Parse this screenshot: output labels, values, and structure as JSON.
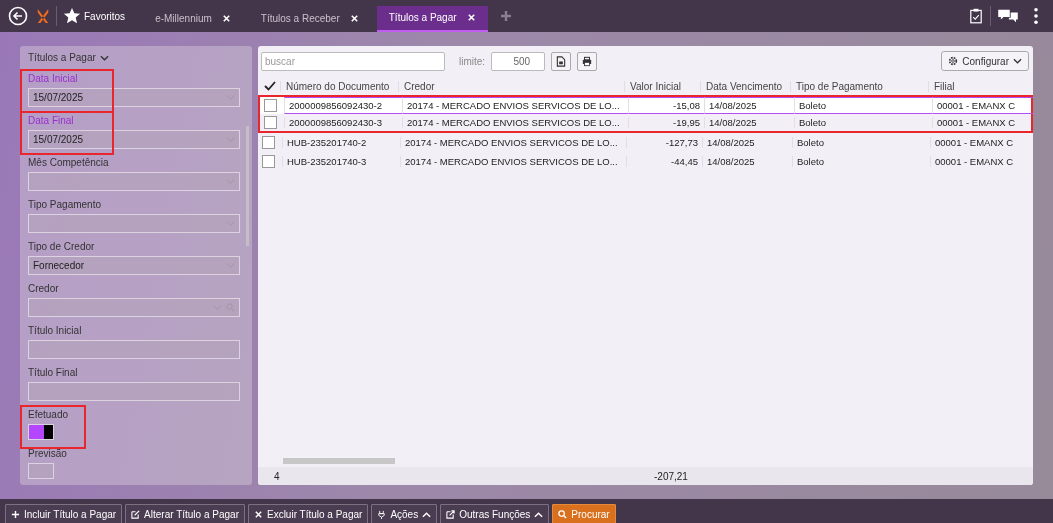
{
  "top_bar": {
    "favorites": {
      "label": "Favoritos"
    },
    "tabs": [
      {
        "label": "e-Millennium",
        "selected": false
      },
      {
        "label": "Títulos a Receber",
        "selected": false
      },
      {
        "label": "Títulos a Pagar",
        "selected": true
      }
    ]
  },
  "filter_panel": {
    "title": "Títulos a Pagar",
    "fields": [
      {
        "label": "Data Inicial",
        "kind": "select",
        "value": "15/07/2025",
        "required": true,
        "highlighted": true
      },
      {
        "label": "Data Final",
        "kind": "select",
        "value": "15/07/2025",
        "required": true,
        "highlighted": true
      },
      {
        "label": "Mês Competência",
        "kind": "select",
        "required": false,
        "highlighted": false
      },
      {
        "label": "Tipo Pagamento",
        "kind": "select",
        "required": false,
        "highlighted": false
      },
      {
        "label": "Tipo de Credor",
        "kind": "select",
        "value": "Fornecedor",
        "required": false,
        "highlighted": false
      },
      {
        "label": "Credor",
        "kind": "lookup",
        "required": false,
        "highlighted": false
      },
      {
        "label": "Título Inicial",
        "kind": "text",
        "required": false,
        "highlighted": false
      },
      {
        "label": "Título Final",
        "kind": "text",
        "required": false,
        "highlighted": false
      },
      {
        "label": "Efetuado",
        "kind": "toggle",
        "on": true,
        "required": false,
        "highlighted": true
      },
      {
        "label": "Previsão",
        "kind": "toggle",
        "on": false,
        "required": false,
        "highlighted": false
      }
    ]
  },
  "results": {
    "search": {
      "placeholder": "buscar"
    },
    "limit": {
      "label": "limite:",
      "value": "500"
    },
    "configure": {
      "label": "Configurar"
    },
    "columns": [
      "Número do Documento",
      "Credor",
      "Valor Inicial",
      "Data Vencimento",
      "Tipo de Pagamento",
      "Filial"
    ],
    "rows": [
      {
        "cells": [
          "2000009856092430-2",
          "20174 - MERCADO ENVIOS SERVICOS DE LO...",
          "-15,08",
          "14/08/2025",
          "Boleto",
          "00001 - EMANX C"
        ],
        "checked": false,
        "selected": true,
        "highlighted": true
      },
      {
        "cells": [
          "2000009856092430-3",
          "20174 - MERCADO ENVIOS SERVICOS DE LO...",
          "-19,95",
          "14/08/2025",
          "Boleto",
          "00001 - EMANX C"
        ],
        "checked": false,
        "selected": false,
        "highlighted": true
      },
      {
        "cells": [
          "HUB-235201740-2",
          "20174 - MERCADO ENVIOS SERVICOS DE LO...",
          "-127,73",
          "14/08/2025",
          "Boleto",
          "00001 - EMANX C"
        ],
        "checked": false,
        "selected": false,
        "highlighted": false
      },
      {
        "cells": [
          "HUB-235201740-3",
          "20174 - MERCADO ENVIOS SERVICOS DE LO...",
          "-44,45",
          "14/08/2025",
          "Boleto",
          "00001 - EMANX C"
        ],
        "checked": false,
        "selected": false,
        "highlighted": false
      }
    ],
    "footer": {
      "count": "4",
      "total": "-207,21"
    }
  },
  "actions": [
    {
      "label": "Incluir Título a Pagar",
      "kind": "add",
      "dropdown": false
    },
    {
      "label": "Alterar Título a Pagar",
      "kind": "edit",
      "dropdown": false
    },
    {
      "label": "Excluir Título a Pagar",
      "kind": "delete",
      "dropdown": false
    },
    {
      "label": "Ações",
      "kind": "actions",
      "dropdown": true
    },
    {
      "label": "Outras Funções",
      "kind": "other",
      "dropdown": true
    },
    {
      "label": "Procurar",
      "kind": "search",
      "dropdown": false
    }
  ]
}
